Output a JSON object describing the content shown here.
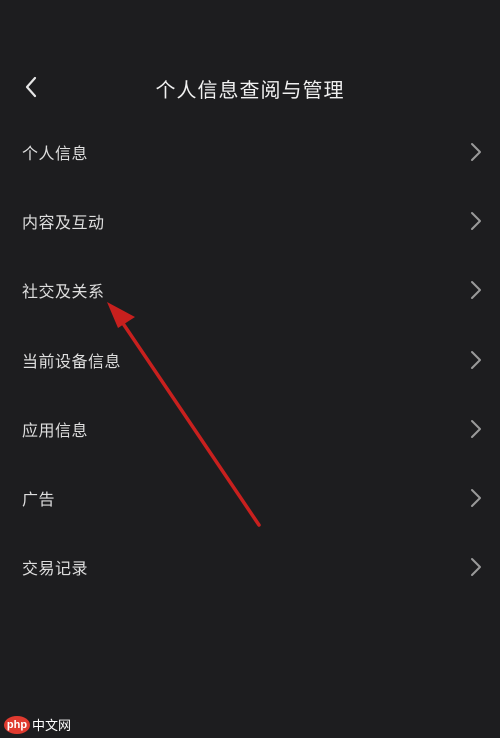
{
  "header": {
    "title": "个人信息查阅与管理",
    "back_icon": "chevron-left-icon"
  },
  "menu": {
    "items": [
      {
        "label": "个人信息"
      },
      {
        "label": "内容及互动"
      },
      {
        "label": "社交及关系"
      },
      {
        "label": "当前设备信息"
      },
      {
        "label": "应用信息"
      },
      {
        "label": "广告"
      },
      {
        "label": "交易记录"
      }
    ],
    "chevron_icon": "chevron-right-icon"
  },
  "annotation": {
    "type": "red-arrow",
    "color": "#c8201e",
    "points_to": "社交及关系"
  },
  "watermark": {
    "badge": "php",
    "text": "中文网"
  },
  "colors": {
    "background": "#1d1d1f",
    "text": "#dedede",
    "chevron": "#9a9a9a"
  }
}
